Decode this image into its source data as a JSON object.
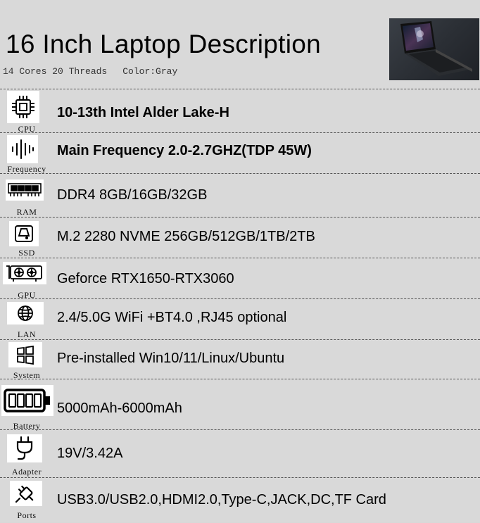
{
  "header": {
    "title": "16 Inch Laptop Description",
    "cores": "14 Cores 20 Threads",
    "color": "Color:Gray"
  },
  "specs": [
    {
      "label": "CPU",
      "icon": "cpu-chip-icon",
      "text": "10-13th Intel Alder Lake-H"
    },
    {
      "label": "Frequency",
      "icon": "frequency-icon",
      "text": "Main Frequency 2.0-2.7GHZ(TDP 45W)"
    },
    {
      "label": "RAM",
      "icon": "ram-module-icon",
      "text": "DDR4 8GB/16GB/32GB"
    },
    {
      "label": "SSD",
      "icon": "ssd-drive-icon",
      "text": "M.2 2280 NVME 256GB/512GB/1TB/2TB"
    },
    {
      "label": "GPU",
      "icon": "graphics-card-icon",
      "text": "Geforce RTX1650-RTX3060"
    },
    {
      "label": "LAN",
      "icon": "globe-icon",
      "text": "2.4/5.0G WiFi +BT4.0 ,RJ45 optional"
    },
    {
      "label": "System",
      "icon": "windows-logo-icon",
      "text": "Pre-installed Win10/11/Linux/Ubuntu"
    },
    {
      "label": "Battery",
      "icon": "battery-icon",
      "text": "5000mAh-6000mAh"
    },
    {
      "label": "Adapter",
      "icon": "power-plug-icon",
      "text": "19V/3.42A"
    },
    {
      "label": "Ports",
      "icon": "usb-connector-icon",
      "text": "USB3.0/USB2.0,HDMI2.0,Type-C,JACK,DC,TF Card"
    }
  ]
}
